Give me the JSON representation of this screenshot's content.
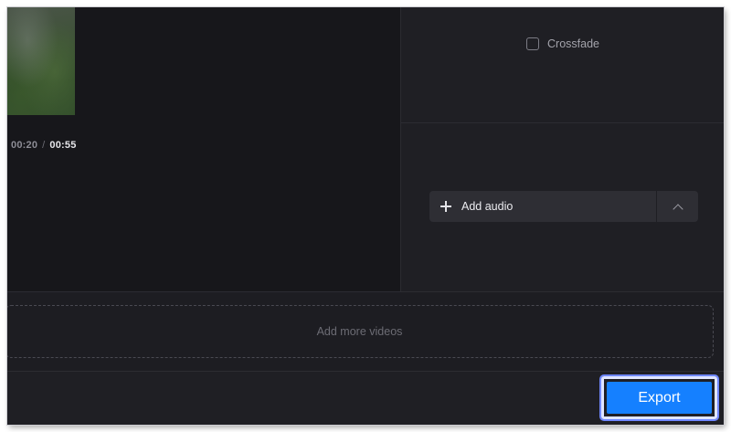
{
  "player": {
    "current_time": "00:20",
    "separator": "/",
    "total_time": "00:55"
  },
  "options": {
    "crossfade_label": "Crossfade",
    "crossfade_checked": false
  },
  "audio": {
    "add_audio_label": "Add audio",
    "expand_icon": "chevron-up-icon"
  },
  "timeline": {
    "add_more_videos_label": "Add more videos"
  },
  "footer": {
    "export_label": "Export",
    "export_color": "#1580ff"
  }
}
